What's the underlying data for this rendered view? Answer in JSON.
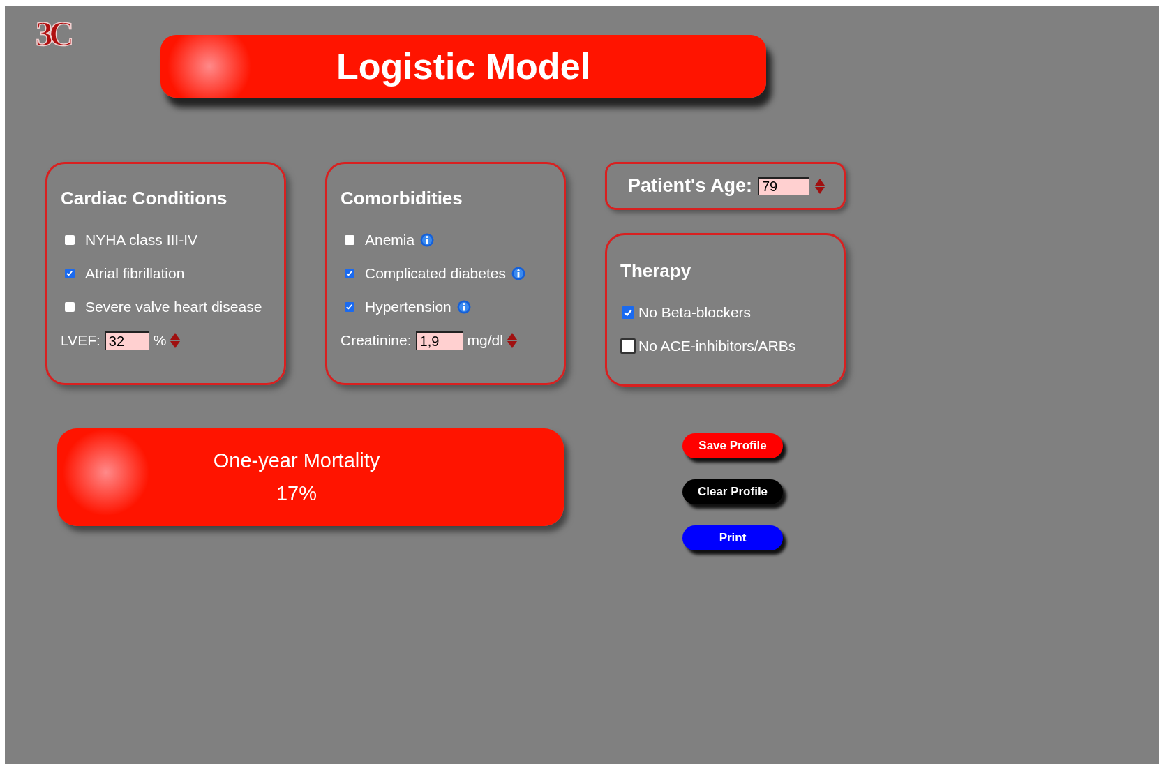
{
  "logo": {
    "text": "3C"
  },
  "header": {
    "title": "Logistic Model"
  },
  "panels": [
    {
      "title": "Cardiac Conditions",
      "items": [
        {
          "label": "NYHA class III-IV",
          "checked": false,
          "info": false
        },
        {
          "label": "Atrial fibrillation",
          "checked": true,
          "info": false
        },
        {
          "label": "Severe valve heart disease",
          "checked": false,
          "info": false
        }
      ],
      "field": {
        "label": "LVEF:",
        "value": "32",
        "unit": "%"
      }
    },
    {
      "title": "Comorbidities",
      "items": [
        {
          "label": "Anemia",
          "checked": false,
          "info": true
        },
        {
          "label": "Complicated diabetes",
          "checked": true,
          "info": true
        },
        {
          "label": "Hypertension",
          "checked": true,
          "info": true
        }
      ],
      "field": {
        "label": "Creatinine:",
        "value": "1,9",
        "unit": "mg/dl"
      }
    }
  ],
  "age": {
    "label": "Patient's Age:",
    "value": "79"
  },
  "therapy": {
    "title": "Therapy",
    "items": [
      {
        "label": "No Beta-blockers",
        "checked": true
      },
      {
        "label": "No ACE-inhibitors/ARBs",
        "checked": false
      }
    ]
  },
  "result": {
    "label": "One-year Mortality",
    "value": "17%"
  },
  "buttons": [
    {
      "label": "Save Profile",
      "kind": "save"
    },
    {
      "label": "Clear Profile",
      "kind": "clear"
    },
    {
      "label": "Print",
      "kind": "print"
    }
  ]
}
